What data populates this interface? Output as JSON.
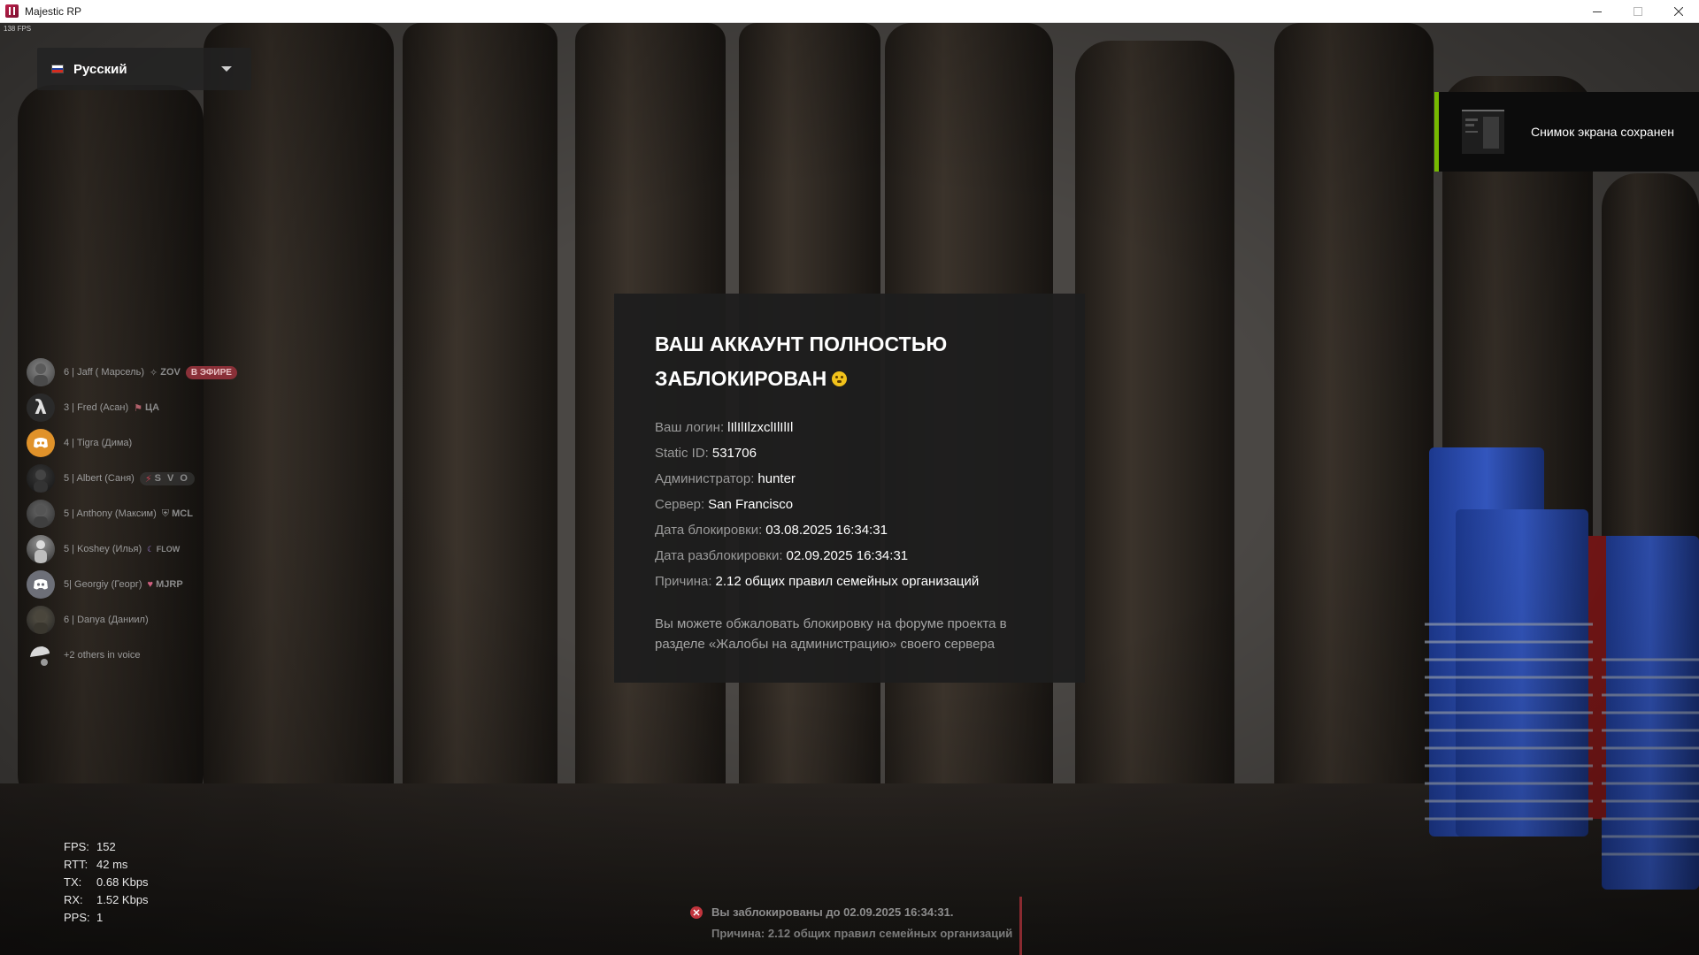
{
  "window": {
    "title": "Majestic RP",
    "controls": [
      "minimize",
      "maximize",
      "close"
    ]
  },
  "hud": {
    "fps_corner": "138 FPS"
  },
  "language_selector": {
    "label": "Русский",
    "flag_colors": [
      "#ffffff",
      "#1c3fa0",
      "#d52b1e"
    ]
  },
  "toast": {
    "text": "Снимок экрана сохранен",
    "accent": "#76b900"
  },
  "voice": {
    "members": [
      {
        "name": "6 | Jaff ( Марсель)",
        "tag_icon": "diamond-icon",
        "tag": "ZOV",
        "badge": "В ЭФИРЕ",
        "avatar": "photo-avatar"
      },
      {
        "name": "3 | Fred (Асан)",
        "tag_icon": "flag-icon",
        "tag": "ЦА",
        "badge": "",
        "avatar": "lambda-avatar"
      },
      {
        "name": "4 | Tigra (Дима)",
        "tag_icon": "",
        "tag": "",
        "badge": "",
        "avatar": "discord-orange-avatar"
      },
      {
        "name": "5 | Albert (Саня)",
        "tag_icon": "bolt-icon",
        "tag": "S V O",
        "badge": "",
        "avatar": "photo-avatar"
      },
      {
        "name": "5 | Anthony (Максим)",
        "tag_icon": "shield-icon",
        "tag": "MCL",
        "badge": "",
        "avatar": "photo-avatar"
      },
      {
        "name": "5 | Koshey (Илья)",
        "tag_icon": "moon-icon",
        "tag": "FLOW",
        "badge": "",
        "avatar": "photo-avatar"
      },
      {
        "name": "5| Georgiy (Георг)",
        "tag_icon": "heart-icon",
        "tag": "MJRP",
        "badge": "",
        "avatar": "discord-gray-avatar"
      },
      {
        "name": "6 | Danya (Даниил)",
        "tag_icon": "",
        "tag": "",
        "badge": "",
        "avatar": "photo-avatar"
      }
    ],
    "others": "+2 others in voice"
  },
  "ban": {
    "title": "ВАШ АККАУНТ ПОЛНОСТЬЮ ЗАБЛОКИРОВАН",
    "title_emoji": "dizzy-face-emoji",
    "fields": [
      {
        "label": "Ваш логин:",
        "value": "lIlIlIlzxclIlIlIl"
      },
      {
        "label": "Static ID:",
        "value": "531706"
      },
      {
        "label": "Администратор:",
        "value": "hunter"
      },
      {
        "label": "Сервер:",
        "value": "San Francisco"
      },
      {
        "label": "Дата блокировки:",
        "value": "03.08.2025 16:34:31"
      },
      {
        "label": "Дата разблокировки:",
        "value": "02.09.2025 16:34:31"
      },
      {
        "label": "Причина:",
        "value": "2.12 общих правил семейных организаций"
      }
    ],
    "note": "Вы можете обжаловать блокировку на форуме проекта в разделе «Жалобы на администрацию» своего сервера"
  },
  "netstats": {
    "rows": [
      {
        "label": "FPS:",
        "value": "152"
      },
      {
        "label": "RTT:",
        "value": "42 ms"
      },
      {
        "label": "TX:",
        "value": "0.68 Kbps"
      },
      {
        "label": "RX:",
        "value": "1.52 Kbps"
      },
      {
        "label": "PPS:",
        "value": "1"
      }
    ]
  },
  "chat": {
    "line1": "Вы заблокированы до 02.09.2025 16:34:31.",
    "line2": "Причина: 2.12 общих правил семейных организаций",
    "accent": "#c1353d"
  }
}
